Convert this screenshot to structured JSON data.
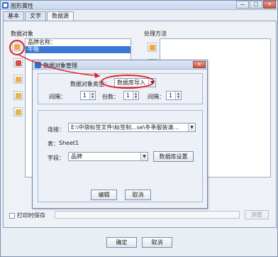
{
  "window": {
    "title": "图形属性",
    "controls": [
      "—",
      "□",
      "✕"
    ]
  },
  "tabs": [
    {
      "label": "基本"
    },
    {
      "label": "文字"
    },
    {
      "label": "数据源"
    }
  ],
  "data_source": {
    "group_label": "数据对象",
    "items": [
      "品牌名称：",
      "牛顿"
    ],
    "selected_index": 1
  },
  "process": {
    "group_label": "处理方法"
  },
  "footer": {
    "print_save_label": "打印时保存",
    "browse_label": "浏览",
    "ok_label": "确定",
    "cancel_label": "取消"
  },
  "dialog": {
    "title": "数据对象管理",
    "close": "✕",
    "type_label": "数据对象类型：",
    "type_value": "数据库导入",
    "interval_label": "间隔：",
    "interval_value": "1",
    "copies_label": "份数：",
    "copies_value": "1",
    "gap_label": "间隔：",
    "gap_value": "1",
    "connect_label": "连接：",
    "connect_value": "E:\\中琅标签文件\\标签制...se\\冬季服装清...",
    "table_label": "表：",
    "table_value": "Sheet1",
    "field_label": "字段：",
    "field_value": "品牌",
    "db_settings_label": "数据库设置",
    "edit_label": "编辑",
    "cancel_label": "取消"
  },
  "colors": {
    "annotation": "#e0202a",
    "selection": "#3979d5"
  }
}
